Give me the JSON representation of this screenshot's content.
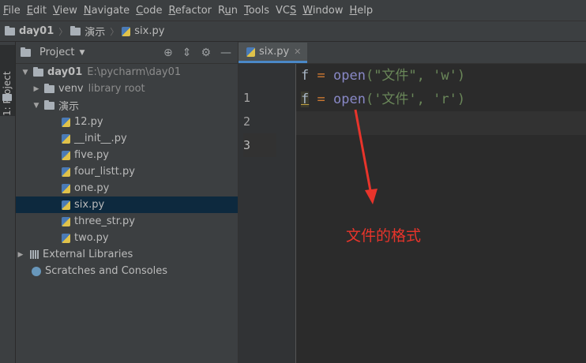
{
  "menu": [
    "File",
    "Edit",
    "View",
    "Navigate",
    "Code",
    "Refactor",
    "Run",
    "Tools",
    "VCS",
    "Window",
    "Help"
  ],
  "menu_mnemonics": [
    "F",
    "E",
    "V",
    "N",
    "C",
    "R",
    "u",
    "T",
    "S",
    "W",
    "H"
  ],
  "breadcrumb": {
    "project": "day01",
    "folder": "演示",
    "file": "six.py"
  },
  "sidestrip": {
    "label": "1: Project"
  },
  "project_panel": {
    "title": "Project",
    "root": {
      "name": "day01",
      "path": "E:\\pycharm\\day01"
    },
    "venv": {
      "name": "venv",
      "hint": "library root"
    },
    "folder": "演示",
    "files": [
      "12.py",
      "__init__.py",
      "five.py",
      "four_listt.py",
      "one.py",
      "six.py",
      "three_str.py",
      "two.py"
    ],
    "selected_file": "six.py",
    "external_libraries": "External Libraries",
    "scratches": "Scratches and Consoles"
  },
  "editor": {
    "tab": "six.py",
    "line_numbers": [
      "1",
      "2",
      "3"
    ],
    "line1": {
      "var": "f",
      "op": "=",
      "fn": "open",
      "args": "(\"文件\", 'w')"
    },
    "line2": {
      "var": "f",
      "op": "=",
      "fn": "open",
      "args": "('文件', 'r')"
    }
  },
  "annotation": {
    "text": "文件的格式",
    "color": "#e8342b"
  },
  "colors": {
    "accent": "#4a88c7",
    "selection": "#0d293e",
    "string": "#6a8759",
    "keyword": "#cc7832"
  }
}
